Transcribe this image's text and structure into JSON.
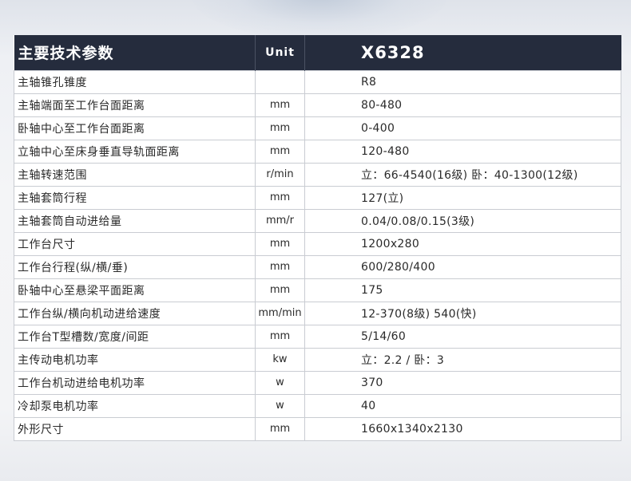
{
  "header": {
    "param_label": "主要技术参数",
    "unit_label": "Unit",
    "model_label": "X6328"
  },
  "rows": [
    {
      "name": "主轴锥孔锥度",
      "unit": "",
      "value": "R8"
    },
    {
      "name": "主轴端面至工作台面距离",
      "unit": "mm",
      "value": "80-480"
    },
    {
      "name": "卧轴中心至工作台面距离",
      "unit": "mm",
      "value": "0-400"
    },
    {
      "name": "立轴中心至床身垂直导轨面距离",
      "unit": "mm",
      "value": "120-480"
    },
    {
      "name": "主轴转速范围",
      "unit": "r/min",
      "value": "立：66-4540(16级) 卧：40-1300(12级)"
    },
    {
      "name": "主轴套筒行程",
      "unit": "mm",
      "value": "127(立)"
    },
    {
      "name": "主轴套筒自动进给量",
      "unit": "mm/r",
      "value": "0.04/0.08/0.15(3级)"
    },
    {
      "name": "工作台尺寸",
      "unit": "mm",
      "value": "1200x280"
    },
    {
      "name": "工作台行程(纵/横/垂)",
      "unit": "mm",
      "value": "600/280/400"
    },
    {
      "name": "卧轴中心至悬梁平面距离",
      "unit": "mm",
      "value": "175"
    },
    {
      "name": "工作台纵/横向机动进给速度",
      "unit": "mm/min",
      "value": "12-370(8级) 540(快)"
    },
    {
      "name": "工作台T型槽数/宽度/间距",
      "unit": "mm",
      "value": "5/14/60"
    },
    {
      "name": "主传动电机功率",
      "unit": "kw",
      "value": "立：2.2 / 卧：3"
    },
    {
      "name": "工作台机动进给电机功率",
      "unit": "w",
      "value": "370"
    },
    {
      "name": "冷却泵电机功率",
      "unit": "w",
      "value": "40"
    },
    {
      "name": "外形尺寸",
      "unit": "mm",
      "value": "1660x1340x2130"
    }
  ]
}
